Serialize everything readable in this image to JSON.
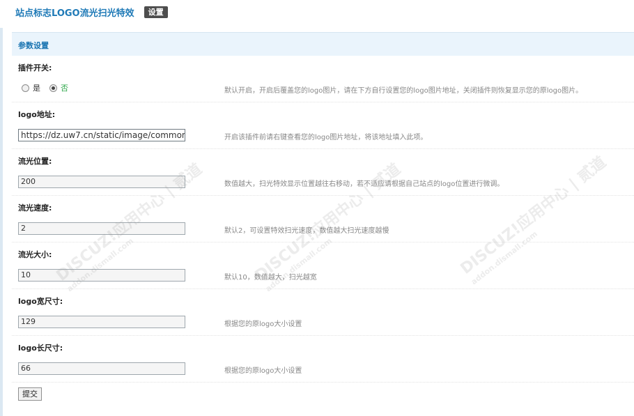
{
  "header": {
    "title": "站点标志LOGO流光扫光特效",
    "settings_tag": "设置"
  },
  "section": {
    "title": "参数设置"
  },
  "fields": [
    {
      "label": "插件开关:",
      "type": "radio",
      "options": [
        "是",
        "否"
      ],
      "selected": "否",
      "tip": "默认开启，开启后覆盖您的logo图片，请在下方自行设置您的logo图片地址，关闭插件则恢复显示您的原logo图片。"
    },
    {
      "label": "logo地址:",
      "type": "text",
      "value": "https://dz.uw7.cn/static/image/common",
      "tip": "开启该插件前请右键查看您的logo图片地址，将该地址填入此项。"
    },
    {
      "label": "流光位置:",
      "type": "text",
      "value": "200",
      "tip": "数值越大，扫光特效显示位置越往右移动，若不适应请根据自己站点的logo位置进行微调。"
    },
    {
      "label": "流光速度:",
      "type": "text",
      "value": "2",
      "tip": "默认2，可设置特效扫光速度，数值越大扫光速度越慢"
    },
    {
      "label": "流光大小:",
      "type": "text",
      "value": "10",
      "tip": "默认10，数值越大，扫光越宽"
    },
    {
      "label": "logo宽尺寸:",
      "type": "text",
      "value": "129",
      "tip": "根据您的原logo大小设置"
    },
    {
      "label": "logo长尺寸:",
      "type": "text",
      "value": "66",
      "tip": "根据您的原logo大小设置"
    }
  ],
  "submit_label": "提交",
  "watermark": {
    "brand": "DISCUZ!应用中心 | 贰道",
    "domain": "addon.dismall.com"
  }
}
